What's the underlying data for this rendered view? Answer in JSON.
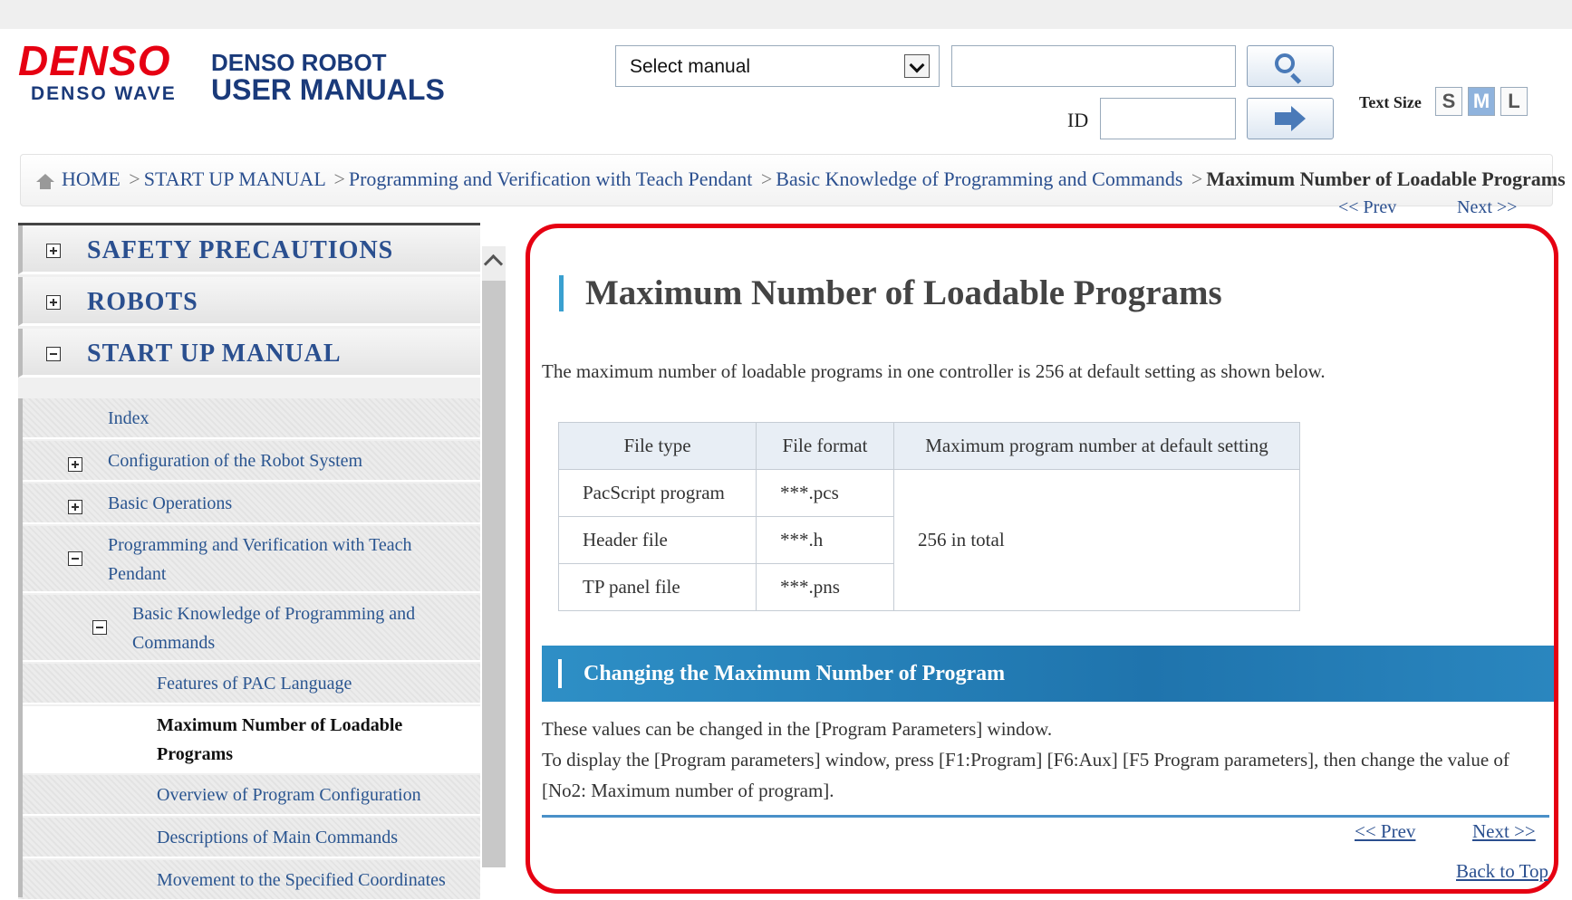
{
  "header": {
    "logo_main": "DENSO",
    "logo_sub": "DENSO WAVE",
    "title_line1": "DENSO ROBOT",
    "title_line2": "USER MANUALS",
    "select_manual": "Select manual",
    "search_value": "",
    "id_label": "ID",
    "id_value": "",
    "text_size_label": "Text Size",
    "text_sizes": [
      "S",
      "M",
      "L"
    ],
    "active_text_size": "M"
  },
  "breadcrumb": {
    "items": [
      "HOME",
      "START UP MANUAL",
      "Programming and Verification with Teach Pendant",
      "Basic Knowledge of Programming and Commands"
    ],
    "current": "Maximum Number of Loadable Programs",
    "separator": ">"
  },
  "nav": {
    "prev": "<< Prev",
    "next": "Next >>",
    "back_to_top": "Back to Top"
  },
  "sidebar": {
    "top_items": [
      "SAFETY PRECAUTIONS",
      "ROBOTS",
      "START UP MANUAL"
    ],
    "sub_items": [
      "Index",
      "Configuration of the Robot System",
      "Basic Operations",
      "Programming and Verification with Teach Pendant",
      "Basic Knowledge of Programming and Commands",
      "Features of PAC Language",
      "Maximum Number of Loadable Programs",
      "Overview of Program Configuration",
      "Descriptions of Main Commands",
      "Movement to the Specified Coordinates"
    ]
  },
  "content": {
    "title": "Maximum Number of Loadable Programs",
    "intro": "The maximum number of loadable programs in one controller is 256 at default setting as shown below.",
    "table": {
      "headers": [
        "File type",
        "File format",
        "Maximum program number at default setting"
      ],
      "rows": [
        [
          "PacScript program",
          "***.pcs"
        ],
        [
          "Header file",
          "***.h"
        ],
        [
          "TP panel file",
          "***.pns"
        ]
      ],
      "merged_value": "256 in total"
    },
    "section_title": "Changing the Maximum Number of Program",
    "para1": "These values can be changed in the [Program Parameters] window.",
    "para2": "To display the [Program parameters] window, press [F1:Program] [F6:Aux] [F5 Program parameters], then change the value of [No2: Maximum number of program]."
  },
  "colors": {
    "brand_red": "#e60012",
    "brand_blue": "#1a3a7a",
    "link": "#2a4f8f",
    "section_bar": "#1f74ad"
  }
}
